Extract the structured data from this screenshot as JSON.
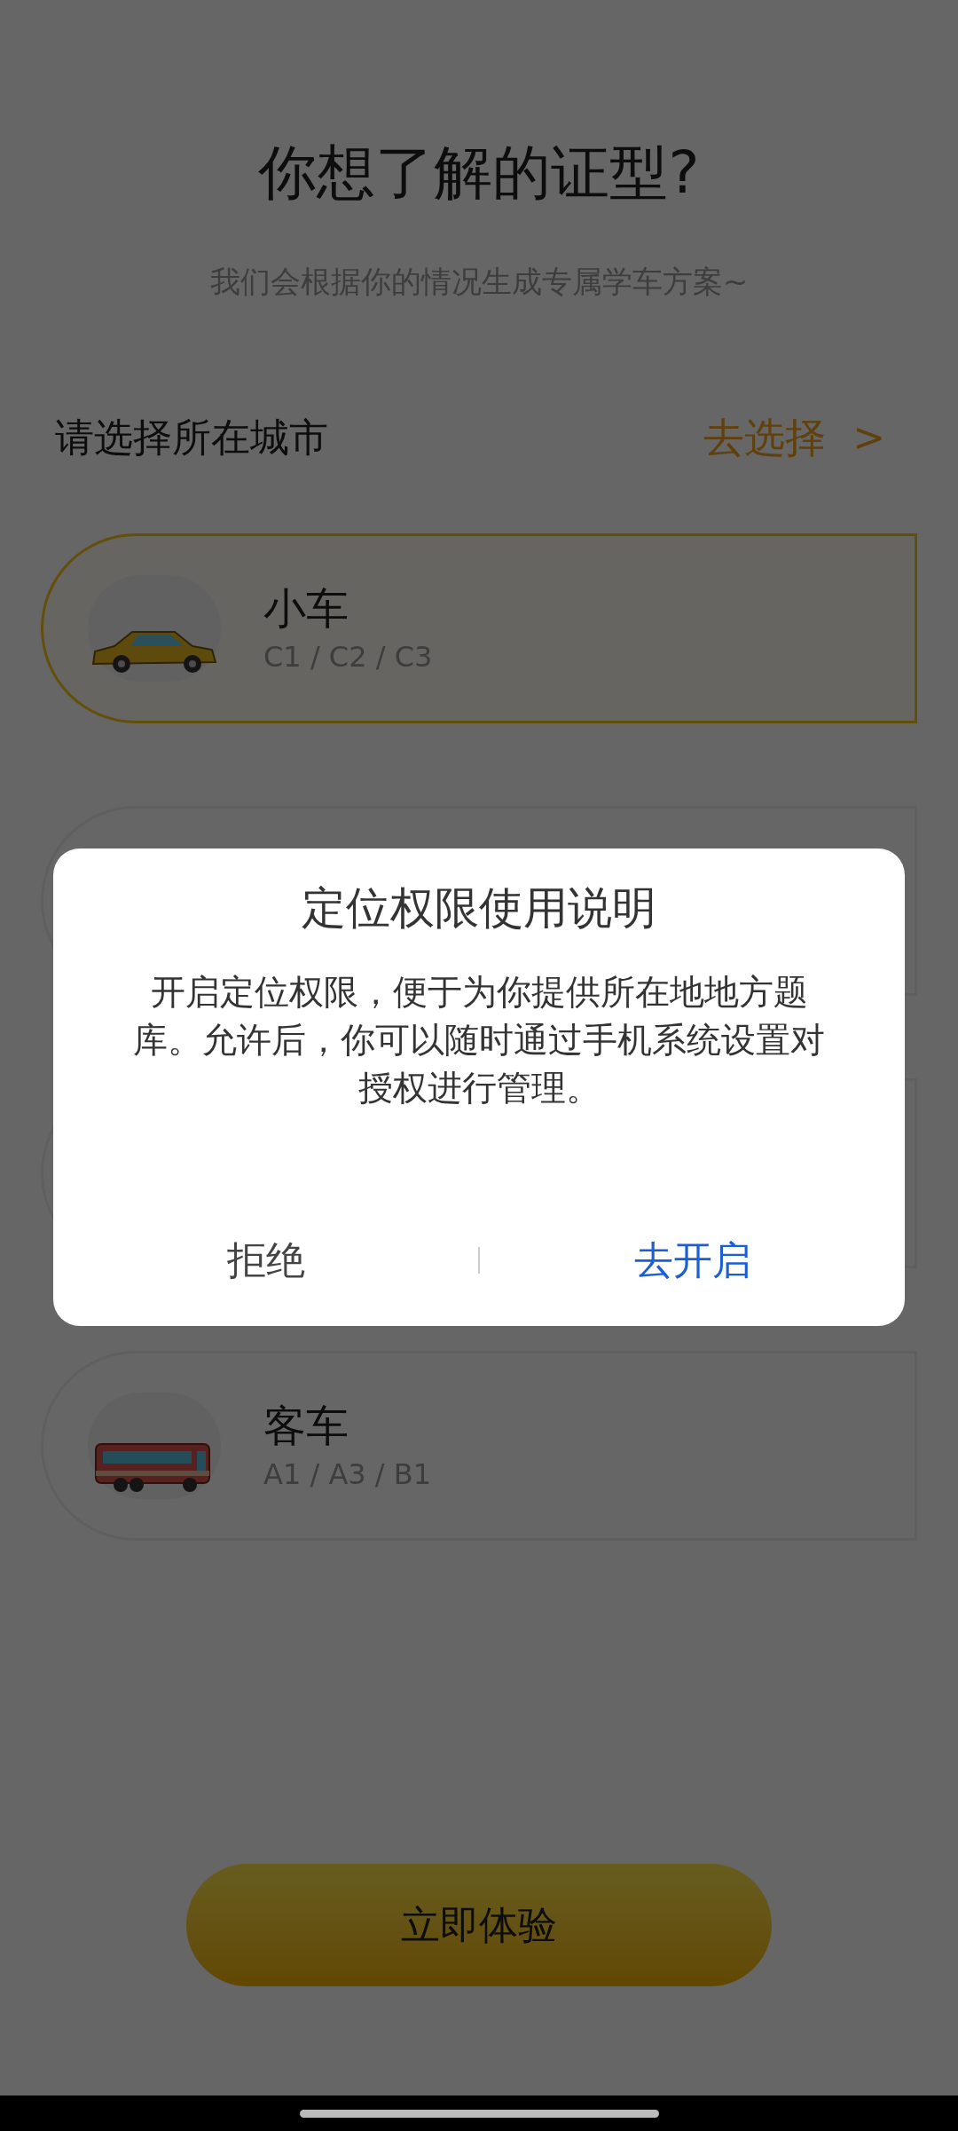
{
  "header": {
    "title": "你想了解的证型?",
    "subtitle": "我们会根据你的情况生成专属学车方案~"
  },
  "city": {
    "label": "请选择所在城市",
    "action": "去选择",
    "chevron": ">"
  },
  "cards": [
    {
      "kind": "car",
      "title": "小车",
      "subtitle": "C1 / C2 / C3",
      "selected": true
    },
    {
      "kind": "hidden",
      "selected": false
    },
    {
      "kind": "hidden",
      "selected": false
    },
    {
      "kind": "bus",
      "title": "客车",
      "subtitle": "A1 / A3 / B1",
      "selected": false
    }
  ],
  "start_button": "立即体验",
  "dialog": {
    "title": "定位权限使用说明",
    "message": "开启定位权限，便于为你提供所在地地方题库。允许后，你可以随时通过手机系统设置对授权进行管理。",
    "buttons": [
      {
        "label": "拒绝",
        "primary": false
      },
      {
        "label": "去开启",
        "primary": true
      }
    ]
  }
}
